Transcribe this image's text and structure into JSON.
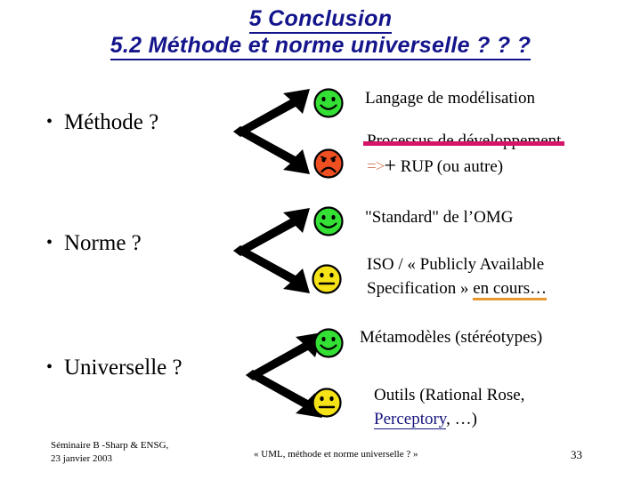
{
  "slide": {
    "title_line1": "5 Conclusion",
    "title_line2": "5.2 Méthode et norme universelle ? ? ?",
    "title_color": "#14148c",
    "background": "#ffffff"
  },
  "colors": {
    "title": "#14148c",
    "happy_face": "#33e033",
    "sad_face": "#f04f22",
    "neutral_face": "#f5e317",
    "strikethrough": "#d6156a",
    "arrow_eq": "#d4866a",
    "underline_en_cours": "#e8962e",
    "link": "#16167e",
    "fork_arrow": "#000000"
  },
  "items": [
    {
      "bullet": "Méthode ?",
      "bullet_marker": "•",
      "fork_icon": "fork-arrows-icon",
      "branches": [
        {
          "face": "happy-face-icon",
          "face_mood": "happy",
          "face_color": "#33e033",
          "text": "Langage de modélisation"
        },
        {
          "face": "sad-face-icon",
          "face_mood": "sad",
          "face_color": "#f04f22",
          "text_struck": "Processus de développement",
          "text_arrow": "=>",
          "text_plus": "+",
          "text_rest": "RUP (ou autre)"
        }
      ]
    },
    {
      "bullet": "Norme ?",
      "bullet_marker": "•",
      "fork_icon": "fork-arrows-icon",
      "branches": [
        {
          "face": "happy-face-icon",
          "face_mood": "happy",
          "face_color": "#33e033",
          "text": "\"Standard\" de l’OMG"
        },
        {
          "face": "neutral-face-icon",
          "face_mood": "neutral",
          "face_color": "#f5e317",
          "text_line1": "ISO / « Publicly Available",
          "text_line2_pre": "Specification » ",
          "text_line2_underlined": "en cours…"
        }
      ]
    },
    {
      "bullet": "Universelle ?",
      "bullet_marker": "•",
      "fork_icon": "fork-arrows-icon",
      "branches": [
        {
          "face": "happy-face-icon",
          "face_mood": "happy",
          "face_color": "#33e033",
          "text": "Métamodèles (stéréotypes)"
        },
        {
          "face": "neutral-face-icon",
          "face_mood": "neutral",
          "face_color": "#f5e317",
          "text_line1": "Outils (Rational Rose,",
          "text_line2_link": "Perceptory",
          "text_line2_rest": ", …)"
        }
      ]
    }
  ],
  "footer": {
    "left_line1": "Séminaire B -Sharp & ENSG,",
    "left_line2": "23 janvier 2003",
    "center": "« UML, méthode et norme universelle ? »",
    "page_number": "33"
  }
}
